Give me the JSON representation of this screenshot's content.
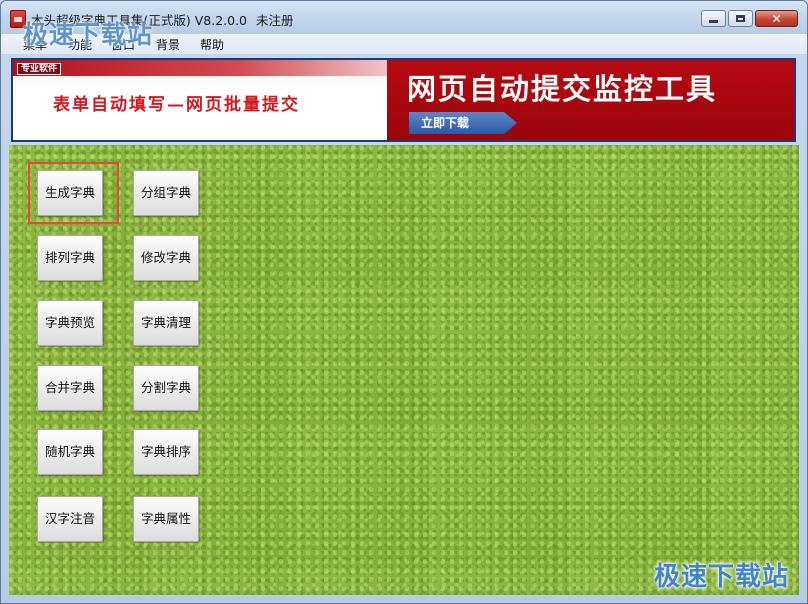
{
  "window": {
    "title": "木头超级字典工具集(正式版) V8.2.0.0",
    "status": "未注册",
    "controls": {
      "minimize": "",
      "maximize": "",
      "close": "✕"
    }
  },
  "watermark": {
    "top": "极速下载站",
    "bottom": "极速下载站"
  },
  "menu": {
    "items": [
      "菜单",
      "功能",
      "窗口",
      "背景",
      "帮助"
    ]
  },
  "banner": {
    "badge": "专业软件",
    "slogan": "表单自动填写—网页批量提交",
    "headline": "网页自动提交监控工具",
    "download_label": "立即下载"
  },
  "tools": {
    "buttons": [
      "生成字典",
      "分组字典",
      "排列字典",
      "修改字典",
      "字典预览",
      "字典清理",
      "合并字典",
      "分割字典",
      "随机字典",
      "字典排序",
      "汉字注音",
      "字典属性"
    ],
    "selected": "生成字典"
  },
  "colors": {
    "highlight": "#e44a38",
    "banner_red": "#b70a12",
    "grass": "#8ab63e",
    "watermark": "#2070c4"
  }
}
